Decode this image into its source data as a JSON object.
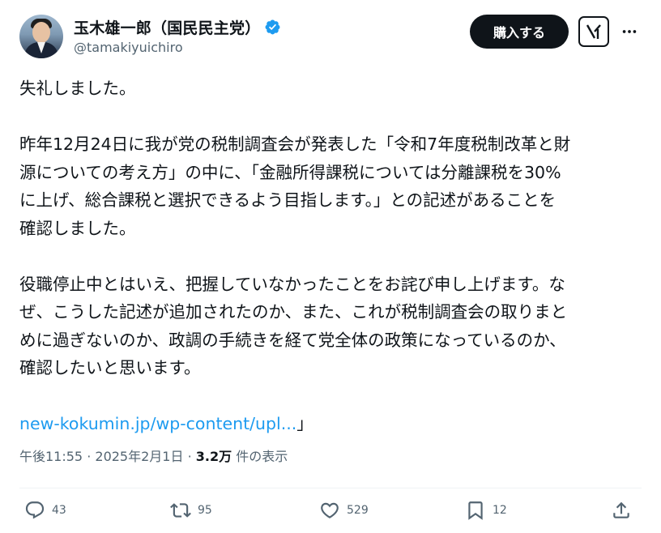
{
  "author": {
    "display_name": "玉木雄一郎（国民民主党）",
    "handle": "@tamakiyuichiro"
  },
  "header": {
    "buy_label": "購入する"
  },
  "post": {
    "lines_p1": [
      "失礼しました。"
    ],
    "lines_p2": [
      "昨年12月24日に我が党の税制調査会が発表した「令和7年度税制改革と財",
      "源についての考え方」の中に、「金融所得課税については分離課税を30%",
      "に上げ、総合課税と選択できるよう目指します。」との記述があることを",
      "確認しました。"
    ],
    "lines_p3": [
      "役職停止中とはいえ、把握していなかったことをお詫び申し上げます。な",
      "ぜ、こうした記述が追加されたのか、また、これが税制調査会の取りまと",
      "めに過ぎないのか、政調の手続きを経て党全体の政策になっているのか、",
      "確認したいと思います。"
    ],
    "link_text": "new-kokumin.jp/wp-content/upl...",
    "link_suffix": "」"
  },
  "meta": {
    "time": "午後11:55",
    "sep1": " · ",
    "date": "2025年2月1日",
    "sep2": " · ",
    "views": "3.2万",
    "views_label": " 件の表示"
  },
  "actions": {
    "reply_count": "43",
    "repost_count": "95",
    "like_count": "529",
    "bookmark_count": "12"
  },
  "colors": {
    "link": "#1d9bf0",
    "verified": "#1d9bf0",
    "muted": "#536471"
  }
}
